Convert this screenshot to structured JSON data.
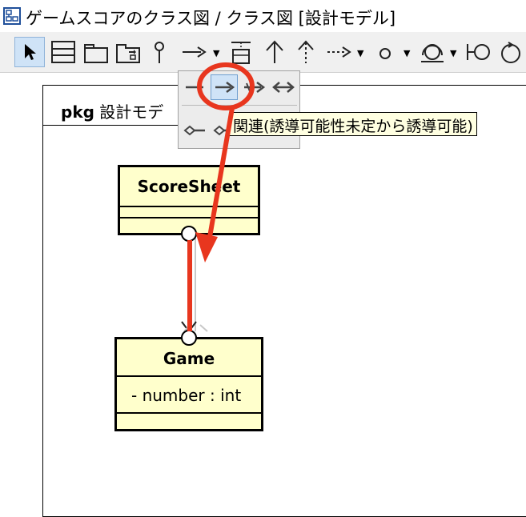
{
  "window": {
    "title": "ゲームスコアのクラス図 / クラス図 [設計モデル]"
  },
  "toolbar": {
    "tools": [
      "select-tool",
      "class-tool",
      "package-tool",
      "subsystem-tool",
      "interface-tool",
      "association-tool",
      "association-class-tool",
      "generalization-tool",
      "realization-tool",
      "dependency-tool",
      "lollipop-tool",
      "required-interface-tool",
      "boundary-tool",
      "control-tool"
    ]
  },
  "popup": {
    "tooltip": "関連(誘導可能性未定から誘導可能)"
  },
  "diagram": {
    "package_keyword": "pkg",
    "package_name": "設計モデ",
    "classes": [
      {
        "name": "ScoreSheet",
        "attributes": []
      },
      {
        "name": "Game",
        "attributes": [
          "- number : int"
        ]
      }
    ]
  },
  "colors": {
    "class_fill": "#ffffcc",
    "highlight_red": "#e8361e",
    "selection_blue": "#cfe3f7",
    "tooltip_bg": "#ffffe1"
  }
}
